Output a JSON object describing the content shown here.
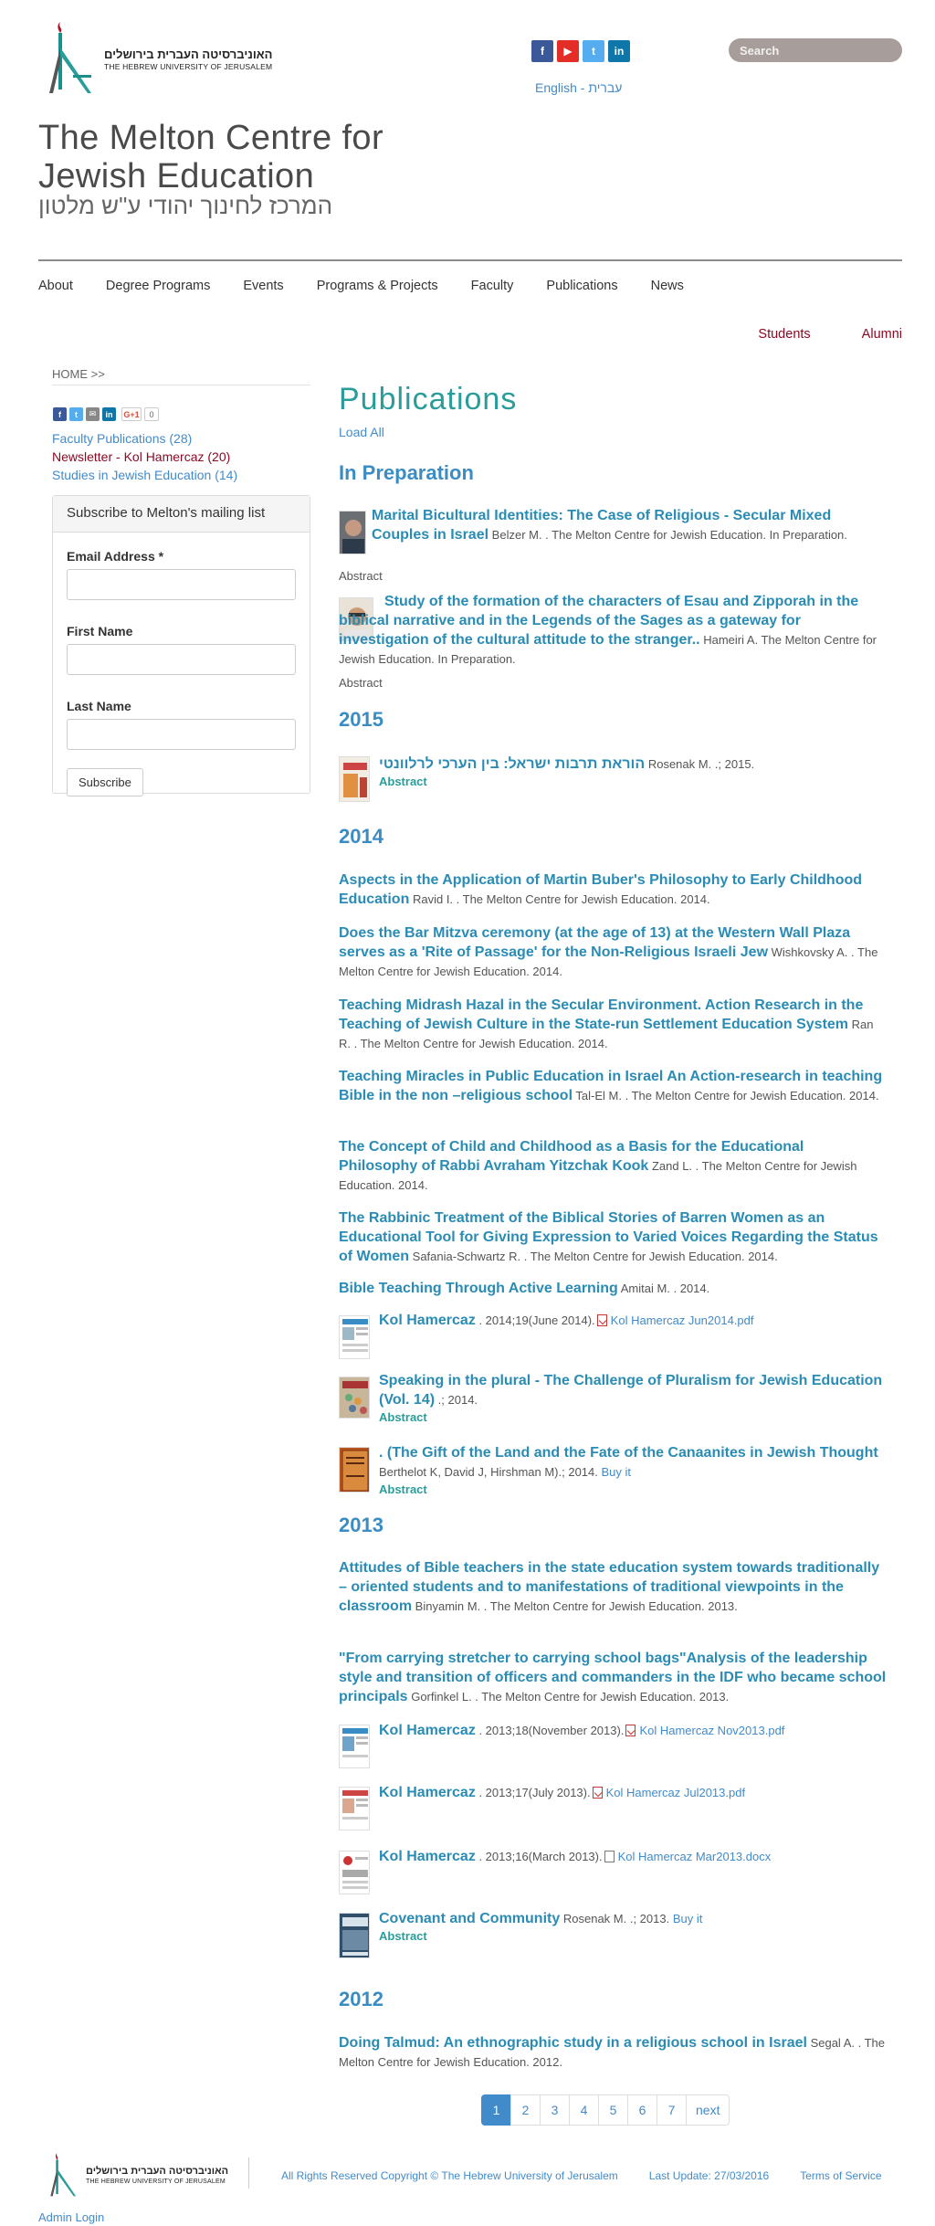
{
  "header": {
    "logo_he": "האוניברסיטה העברית בירושלים",
    "logo_en": "THE HEBREW UNIVERSITY OF JERUSALEM",
    "social": [
      {
        "icon": "facebook-icon",
        "glyph": "f",
        "color": "#3b5998"
      },
      {
        "icon": "youtube-icon",
        "glyph": "▶",
        "color": "#e52d27"
      },
      {
        "icon": "twitter-icon",
        "glyph": "t",
        "color": "#55acee"
      },
      {
        "icon": "linkedin-icon",
        "glyph": "in",
        "color": "#0e76a8"
      }
    ],
    "lang_en": "English",
    "lang_sep": " - ",
    "lang_he": "עברית",
    "search_placeholder": "Search",
    "title_line1": "The Melton Centre for",
    "title_line2": "Jewish Education",
    "subtitle_he": "המרכז לחינוך יהודי ע\"ש מלטון"
  },
  "nav": {
    "items": [
      "About",
      "Degree Programs",
      "Events",
      "Programs & Projects",
      "Faculty",
      "Publications",
      "News"
    ],
    "secondary": [
      "Students",
      "Alumni"
    ]
  },
  "sidebar": {
    "breadcrumb": "HOME >>",
    "share_count": "0",
    "links": [
      {
        "label": "Faculty Publications (28)",
        "active": false
      },
      {
        "label": "Newsletter - Kol Hamercaz (20)",
        "active": true
      },
      {
        "label": "Studies in Jewish Education (14)",
        "active": false
      }
    ],
    "mailing": {
      "title": "Subscribe to Melton's mailing list",
      "email_label": "Email Address *",
      "first_label": "First Name",
      "last_label": "Last Name",
      "button": "Subscribe"
    }
  },
  "main": {
    "title": "Publications",
    "load_all": "Load All",
    "abstract_label": "Abstract",
    "sections": {
      "prep": "In Preparation",
      "y2015": "2015",
      "y2014": "2014",
      "y2013": "2013",
      "y2012": "2012"
    },
    "items": [
      {
        "title": "Marital Bicultural Identities: The Case of Religious - Secular Mixed Couples in Israel",
        "meta": "Belzer M. . The Melton Centre for Jewish Education. In Preparation."
      },
      {
        "title": "Study of the formation of the characters of Esau and Zipporah in the biblical narrative and in the Legends of the Sages as a gateway for investigation of the cultural attitude to the stranger..",
        "meta": "Hameiri A. The Melton Centre for Jewish Education. In Preparation."
      },
      {
        "title": "הוראת תרבות ישראל: בין הערכי לרלוונטי",
        "meta": "Rosenak M. .; 2015."
      },
      {
        "title": "Aspects in the Application of Martin Buber's Philosophy to Early Childhood Education",
        "meta": "Ravid I. . The Melton Centre for Jewish Education. 2014."
      },
      {
        "title": "Does the Bar Mitzva ceremony (at the age of 13) at the Western Wall Plaza serves as a 'Rite of Passage' for the Non-Religious Israeli Jew",
        "meta": "Wishkovsky A. . The Melton Centre for Jewish Education. 2014."
      },
      {
        "title": "Teaching Midrash Hazal in the Secular Environment. Action Research in the Teaching of Jewish Culture in the State-run Settlement Education System",
        "meta": "Ran R. . The Melton Centre for Jewish Education. 2014."
      },
      {
        "title": "Teaching Miracles in Public Education in Israel An Action-research in teaching Bible in the non –religious school",
        "meta": "Tal-El M. . The Melton Centre for Jewish Education. 2014."
      },
      {
        "title": "The Concept of Child and Childhood as a Basis for the Educational Philosophy of Rabbi Avraham Yitzchak Kook",
        "meta": "Zand L. . The Melton Centre for Jewish Education. 2014."
      },
      {
        "title": "The Rabbinic Treatment of the Biblical Stories of Barren Women as an Educational Tool for Giving Expression to Varied Voices Regarding the Status of Women",
        "meta": "Safania-Schwartz R. . The Melton Centre for Jewish Education. 2014."
      },
      {
        "title": "Bible Teaching Through Active Learning",
        "meta": "Amitai M. . 2014."
      },
      {
        "title": "Kol Hamercaz",
        "meta": ". 2014;19(June 2014).",
        "file": "Kol Hamercaz Jun2014.pdf"
      },
      {
        "title": "Speaking in the plural - The Challenge of Pluralism for Jewish Education (Vol. 14)",
        "meta": ".; 2014."
      },
      {
        "title": ". (The Gift of the Land and the Fate of the Canaanites in Jewish Thought",
        "meta": "Berthelot K, David J, Hirshman M).; 2014.",
        "link": "Buy it"
      },
      {
        "title": "Attitudes of Bible teachers in the state education system towards traditionally – oriented students and to manifestations of traditional viewpoints in the classroom",
        "meta": "Binyamin M. . The Melton Centre for Jewish Education. 2013."
      },
      {
        "title": "\"From carrying stretcher to carrying school bags\"Analysis of the leadership style and transition of officers and commanders in the IDF who became school principals",
        "meta": "Gorfinkel L. . The Melton Centre for Jewish Education. 2013."
      },
      {
        "title": "Kol Hamercaz",
        "meta": ". 2013;18(November 2013).",
        "file": "Kol Hamercaz Nov2013.pdf"
      },
      {
        "title": "Kol Hamercaz",
        "meta": ". 2013;17(July 2013).",
        "file": "Kol Hamercaz Jul2013.pdf"
      },
      {
        "title": "Kol Hamercaz",
        "meta": ". 2013;16(March 2013).",
        "file": "Kol Hamercaz Mar2013.docx"
      },
      {
        "title": "Covenant and Community",
        "meta": "Rosenak M. .; 2013.",
        "link": "Buy it"
      },
      {
        "title": "Doing Talmud: An ethnographic study in a religious school in Israel",
        "meta": "Segal A. . The Melton Centre for Jewish Education. 2012."
      }
    ]
  },
  "pagination": {
    "pages": [
      "1",
      "2",
      "3",
      "4",
      "5",
      "6",
      "7"
    ],
    "next": "next",
    "current": "1"
  },
  "footer": {
    "logo_he": "האוניברסיטה העברית בירושלים",
    "logo_en": "THE HEBREW UNIVERSITY OF JERUSALEM",
    "copyright": "All Rights Reserved Copyright © The Hebrew University of Jerusalem",
    "last_update": "Last Update: 27/03/2016",
    "terms": "Terms of Service",
    "admin_login": "Admin Login"
  },
  "colors": {
    "accent_teal": "#2a9d9a",
    "link_blue": "#428bca",
    "nav_red": "#8b0a24"
  }
}
